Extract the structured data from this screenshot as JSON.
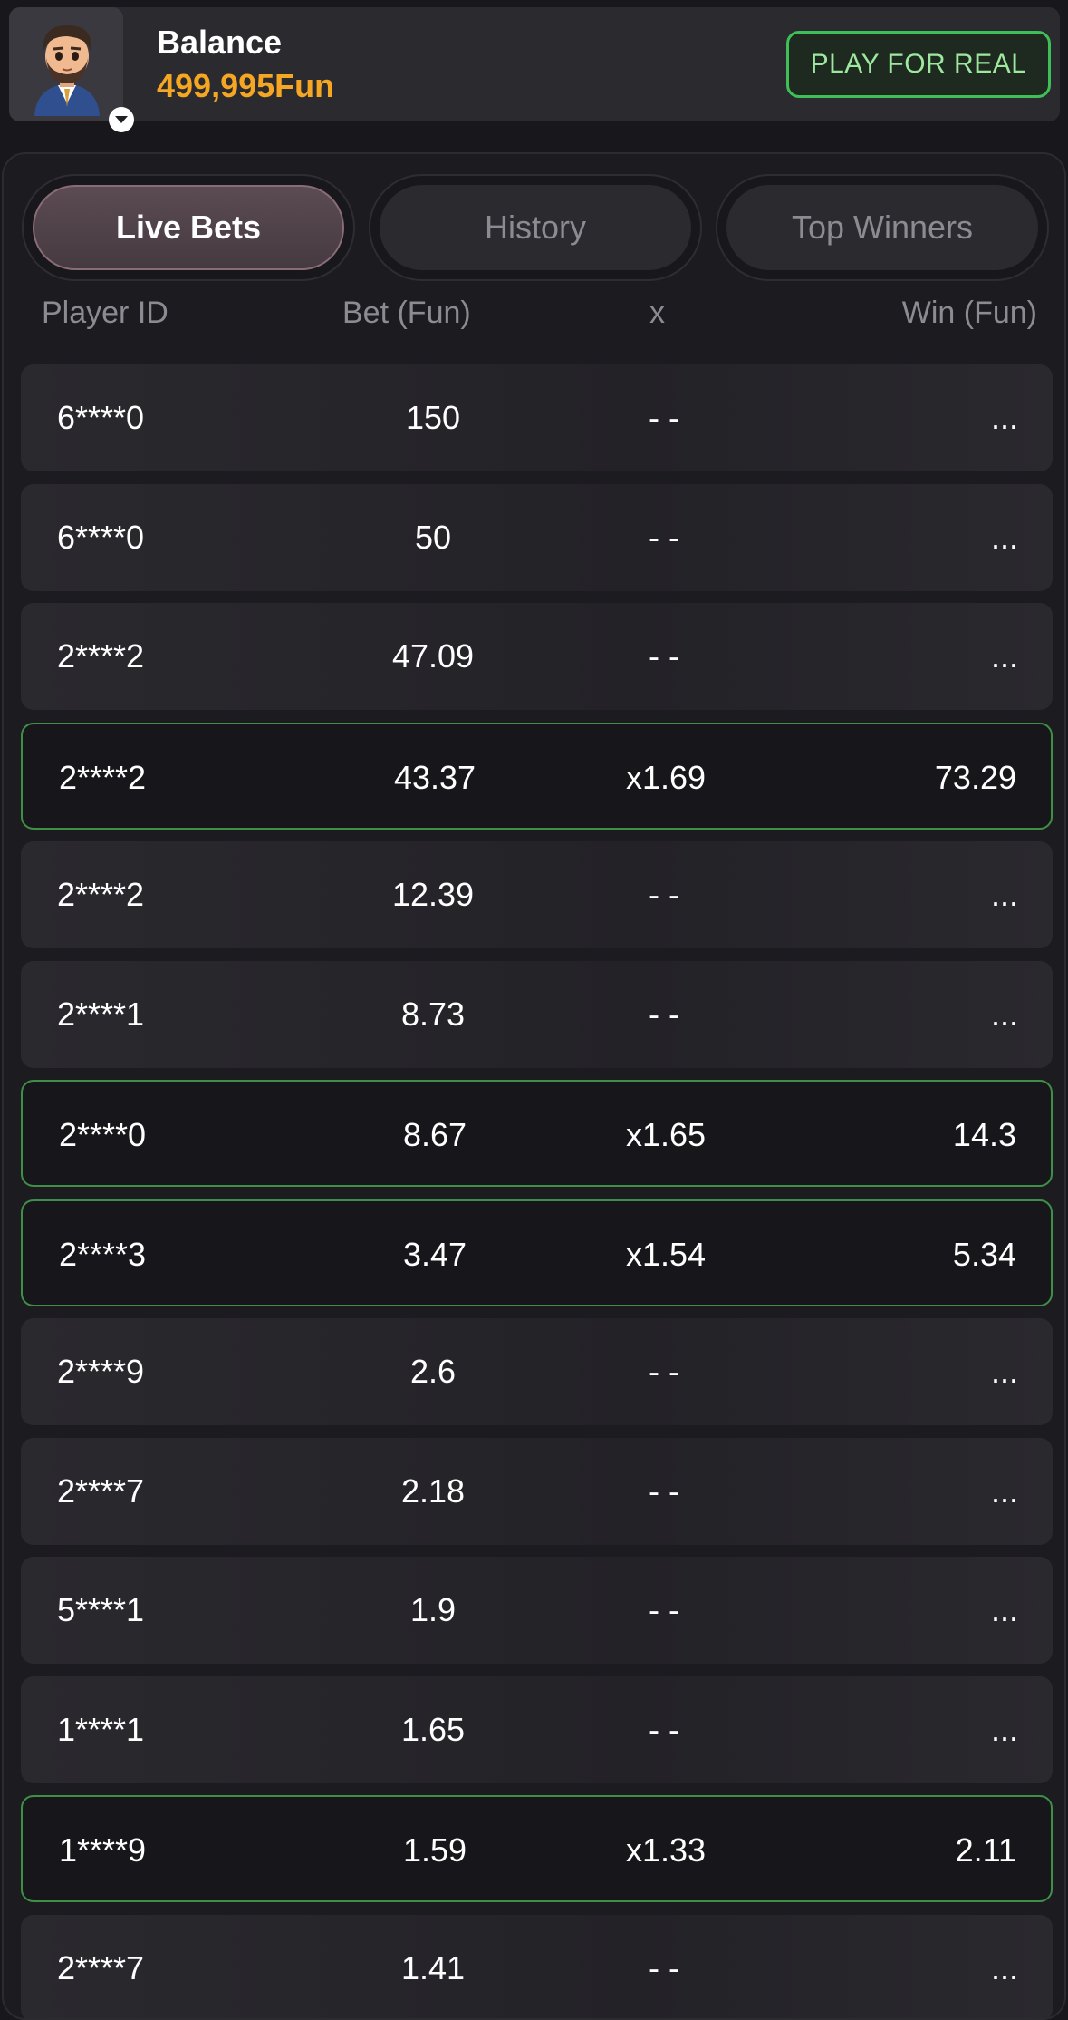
{
  "header": {
    "balance_label": "Balance",
    "balance_value": "499,995Fun",
    "play_button": "PLAY FOR REAL"
  },
  "tabs": [
    {
      "label": "Live Bets",
      "active": true
    },
    {
      "label": "History",
      "active": false
    },
    {
      "label": "Top Winners",
      "active": false
    }
  ],
  "columns": {
    "player_id": "Player ID",
    "bet": "Bet (Fun)",
    "x": "x",
    "win": "Win (Fun)"
  },
  "rows": [
    {
      "player": "6****0",
      "bet": "150",
      "x": "- -",
      "win": "...",
      "won": false
    },
    {
      "player": "6****0",
      "bet": "50",
      "x": "- -",
      "win": "...",
      "won": false
    },
    {
      "player": "2****2",
      "bet": "47.09",
      "x": "- -",
      "win": "...",
      "won": false
    },
    {
      "player": "2****2",
      "bet": "43.37",
      "x": "x1.69",
      "win": "73.29",
      "won": true
    },
    {
      "player": "2****2",
      "bet": "12.39",
      "x": "- -",
      "win": "...",
      "won": false
    },
    {
      "player": "2****1",
      "bet": "8.73",
      "x": "- -",
      "win": "...",
      "won": false
    },
    {
      "player": "2****0",
      "bet": "8.67",
      "x": "x1.65",
      "win": "14.3",
      "won": true
    },
    {
      "player": "2****3",
      "bet": "3.47",
      "x": "x1.54",
      "win": "5.34",
      "won": true
    },
    {
      "player": "2****9",
      "bet": "2.6",
      "x": "- -",
      "win": "...",
      "won": false
    },
    {
      "player": "2****7",
      "bet": "2.18",
      "x": "- -",
      "win": "...",
      "won": false
    },
    {
      "player": "5****1",
      "bet": "1.9",
      "x": "- -",
      "win": "...",
      "won": false
    },
    {
      "player": "1****1",
      "bet": "1.65",
      "x": "- -",
      "win": "...",
      "won": false
    },
    {
      "player": "1****9",
      "bet": "1.59",
      "x": "x1.33",
      "win": "2.11",
      "won": true
    },
    {
      "player": "2****7",
      "bet": "1.41",
      "x": "- -",
      "win": "...",
      "won": false
    }
  ],
  "colors": {
    "accent_balance": "#f5a623",
    "win_border": "#3f8f48",
    "play_border": "#3fbf57"
  },
  "icons": {
    "avatar": "avatar-icon",
    "dropdown": "chevron-down-icon"
  }
}
